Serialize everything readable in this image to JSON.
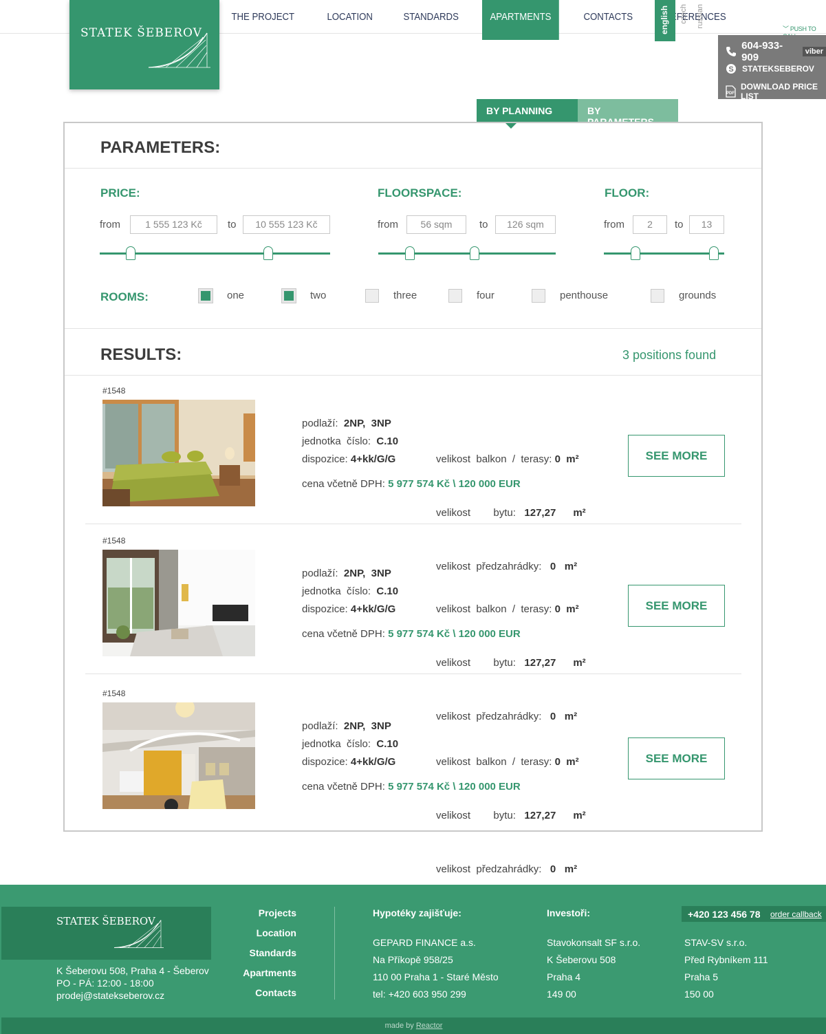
{
  "header": {
    "logo_text": "STATEK ŠEBEROV",
    "nav": [
      "THE PROJECT",
      "LOCATION",
      "STANDARDS",
      "APARTMENTS",
      "CONTACTS",
      "REFERENCES"
    ],
    "active_nav": "APARTMENTS",
    "languages": [
      "english",
      "czech",
      "russian"
    ],
    "active_language": "english",
    "push_to_call": "PUSH TO CALL",
    "phone": "604-933-909",
    "viber": "viber",
    "skype": "STATEKSEBEROV",
    "download": "DOWNLOAD PRICE LIST"
  },
  "tabs": [
    "BY PLANNING",
    "BY PARAMETERS"
  ],
  "parameters": {
    "title": "PARAMETERS:",
    "price": {
      "label": "PRICE:",
      "from_label": "from",
      "to_label": "to",
      "from": "1 555 123 Kč",
      "to": "10 555 123 Kč"
    },
    "floorspace": {
      "label": "FLOORSPACE:",
      "from_label": "from",
      "to_label": "to",
      "from": "56 sqm",
      "to": "126 sqm"
    },
    "floor": {
      "label": "FLOOR:",
      "from_label": "from",
      "to_label": "to",
      "from": "2",
      "to": "13"
    },
    "rooms": {
      "label": "ROOMS:",
      "options": [
        {
          "label": "one",
          "checked": true
        },
        {
          "label": "two",
          "checked": true
        },
        {
          "label": "three",
          "checked": false
        },
        {
          "label": "four",
          "checked": false
        },
        {
          "label": "penthouse",
          "checked": false
        },
        {
          "label": "grounds",
          "checked": false
        }
      ]
    }
  },
  "results": {
    "title": "RESULTS:",
    "count_text": "3 positions found",
    "items": [
      {
        "id": "#1548",
        "photo": "bedroom",
        "podlazi_label": "podlaží:",
        "podlazi": "2NP,  3NP",
        "jednotka_label": "jednotka  číslo:",
        "jednotka": "C.10",
        "dispozice_label": "dispozice:",
        "dispozice": "4+kk/G/G",
        "balkon_label": "velikost  balkon  /  terasy:",
        "balkon": "0",
        "bytu_label": "velikost        bytu:",
        "bytu": "127,27",
        "predzahradky_label": "velikost  předzahrádky:",
        "predzahradky": "0",
        "unit": "m²",
        "price_label": "cena včetně DPH:",
        "price": "5 977 574 Kč \\ 120 000 EUR",
        "button": "SEE MORE"
      },
      {
        "id": "#1548",
        "photo": "living-room",
        "podlazi_label": "podlaží:",
        "podlazi": "2NP,  3NP",
        "jednotka_label": "jednotka  číslo:",
        "jednotka": "C.10",
        "dispozice_label": "dispozice:",
        "dispozice": "4+kk/G/G",
        "balkon_label": "velikost  balkon  /  terasy:",
        "balkon": "0",
        "bytu_label": "velikost        bytu:",
        "bytu": "127,27",
        "predzahradky_label": "velikost  předzahrádky:",
        "predzahradky": "0",
        "unit": "m²",
        "price_label": "cena včetně DPH:",
        "price": "5 977 574 Kč \\ 120 000 EUR",
        "button": "SEE MORE"
      },
      {
        "id": "#1548",
        "photo": "loft",
        "podlazi_label": "podlaží:",
        "podlazi": "2NP,  3NP",
        "jednotka_label": "jednotka  číslo:",
        "jednotka": "C.10",
        "dispozice_label": "dispozice:",
        "dispozice": "4+kk/G/G",
        "balkon_label": "velikost  balkon  /  terasy:",
        "balkon": "0",
        "bytu_label": "velikost        bytu:",
        "bytu": "127,27",
        "predzahradky_label": "velikost  předzahrádky:",
        "predzahradky": "0",
        "unit": "m²",
        "price_label": "cena včetně DPH:",
        "price": "5 977 574 Kč \\ 120 000 EUR",
        "button": "SEE MORE"
      }
    ]
  },
  "footer": {
    "logo_text": "STATEK ŠEBEROV",
    "address": [
      "K Šeberovu 508, Praha 4 - Šeberov",
      "PO - PÁ: 12:00 - 18:00",
      "prodej@statekseberov.cz"
    ],
    "links": [
      "Projects",
      "Location",
      "Standards",
      "Apartments",
      "Contacts"
    ],
    "mortgage_title": "Hypotéky zajišťuje:",
    "mortgage": [
      "GEPARD FINANCE a.s.",
      "Na Příkopě 958/25",
      "110 00 Praha 1 - Staré Město",
      "tel: +420 603 950 299"
    ],
    "investors_title": "Investoři:",
    "investor1": [
      "Stavokonsalt SF s.r.o.",
      "K Šeberovu 508",
      "Praha 4",
      "149 00"
    ],
    "investor2": [
      "STAV-SV s.r.o.",
      "Před Rybníkem 111",
      "Praha 5",
      "150 00"
    ],
    "phone": "+420 123 456 78",
    "callback": "order callback",
    "made_by": "made by",
    "made_by_link": "Reactor"
  },
  "colors": {
    "accent": "#35966e",
    "accent_light": "#7dbd9e",
    "footer": "#3b9a71",
    "footer_dark": "#2a7f59"
  }
}
